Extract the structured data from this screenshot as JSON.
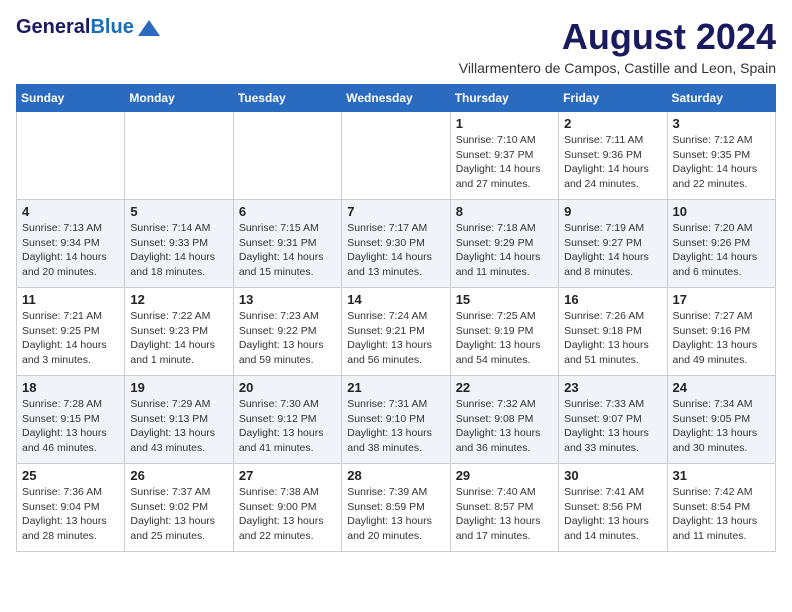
{
  "header": {
    "logo_line1": "General",
    "logo_line2": "Blue",
    "month_year": "August 2024",
    "location": "Villarmentero de Campos, Castille and Leon, Spain"
  },
  "weekdays": [
    "Sunday",
    "Monday",
    "Tuesday",
    "Wednesday",
    "Thursday",
    "Friday",
    "Saturday"
  ],
  "weeks": [
    [
      {
        "day": "",
        "info": ""
      },
      {
        "day": "",
        "info": ""
      },
      {
        "day": "",
        "info": ""
      },
      {
        "day": "",
        "info": ""
      },
      {
        "day": "1",
        "info": "Sunrise: 7:10 AM\nSunset: 9:37 PM\nDaylight: 14 hours\nand 27 minutes."
      },
      {
        "day": "2",
        "info": "Sunrise: 7:11 AM\nSunset: 9:36 PM\nDaylight: 14 hours\nand 24 minutes."
      },
      {
        "day": "3",
        "info": "Sunrise: 7:12 AM\nSunset: 9:35 PM\nDaylight: 14 hours\nand 22 minutes."
      }
    ],
    [
      {
        "day": "4",
        "info": "Sunrise: 7:13 AM\nSunset: 9:34 PM\nDaylight: 14 hours\nand 20 minutes."
      },
      {
        "day": "5",
        "info": "Sunrise: 7:14 AM\nSunset: 9:33 PM\nDaylight: 14 hours\nand 18 minutes."
      },
      {
        "day": "6",
        "info": "Sunrise: 7:15 AM\nSunset: 9:31 PM\nDaylight: 14 hours\nand 15 minutes."
      },
      {
        "day": "7",
        "info": "Sunrise: 7:17 AM\nSunset: 9:30 PM\nDaylight: 14 hours\nand 13 minutes."
      },
      {
        "day": "8",
        "info": "Sunrise: 7:18 AM\nSunset: 9:29 PM\nDaylight: 14 hours\nand 11 minutes."
      },
      {
        "day": "9",
        "info": "Sunrise: 7:19 AM\nSunset: 9:27 PM\nDaylight: 14 hours\nand 8 minutes."
      },
      {
        "day": "10",
        "info": "Sunrise: 7:20 AM\nSunset: 9:26 PM\nDaylight: 14 hours\nand 6 minutes."
      }
    ],
    [
      {
        "day": "11",
        "info": "Sunrise: 7:21 AM\nSunset: 9:25 PM\nDaylight: 14 hours\nand 3 minutes."
      },
      {
        "day": "12",
        "info": "Sunrise: 7:22 AM\nSunset: 9:23 PM\nDaylight: 14 hours\nand 1 minute."
      },
      {
        "day": "13",
        "info": "Sunrise: 7:23 AM\nSunset: 9:22 PM\nDaylight: 13 hours\nand 59 minutes."
      },
      {
        "day": "14",
        "info": "Sunrise: 7:24 AM\nSunset: 9:21 PM\nDaylight: 13 hours\nand 56 minutes."
      },
      {
        "day": "15",
        "info": "Sunrise: 7:25 AM\nSunset: 9:19 PM\nDaylight: 13 hours\nand 54 minutes."
      },
      {
        "day": "16",
        "info": "Sunrise: 7:26 AM\nSunset: 9:18 PM\nDaylight: 13 hours\nand 51 minutes."
      },
      {
        "day": "17",
        "info": "Sunrise: 7:27 AM\nSunset: 9:16 PM\nDaylight: 13 hours\nand 49 minutes."
      }
    ],
    [
      {
        "day": "18",
        "info": "Sunrise: 7:28 AM\nSunset: 9:15 PM\nDaylight: 13 hours\nand 46 minutes."
      },
      {
        "day": "19",
        "info": "Sunrise: 7:29 AM\nSunset: 9:13 PM\nDaylight: 13 hours\nand 43 minutes."
      },
      {
        "day": "20",
        "info": "Sunrise: 7:30 AM\nSunset: 9:12 PM\nDaylight: 13 hours\nand 41 minutes."
      },
      {
        "day": "21",
        "info": "Sunrise: 7:31 AM\nSunset: 9:10 PM\nDaylight: 13 hours\nand 38 minutes."
      },
      {
        "day": "22",
        "info": "Sunrise: 7:32 AM\nSunset: 9:08 PM\nDaylight: 13 hours\nand 36 minutes."
      },
      {
        "day": "23",
        "info": "Sunrise: 7:33 AM\nSunset: 9:07 PM\nDaylight: 13 hours\nand 33 minutes."
      },
      {
        "day": "24",
        "info": "Sunrise: 7:34 AM\nSunset: 9:05 PM\nDaylight: 13 hours\nand 30 minutes."
      }
    ],
    [
      {
        "day": "25",
        "info": "Sunrise: 7:36 AM\nSunset: 9:04 PM\nDaylight: 13 hours\nand 28 minutes."
      },
      {
        "day": "26",
        "info": "Sunrise: 7:37 AM\nSunset: 9:02 PM\nDaylight: 13 hours\nand 25 minutes."
      },
      {
        "day": "27",
        "info": "Sunrise: 7:38 AM\nSunset: 9:00 PM\nDaylight: 13 hours\nand 22 minutes."
      },
      {
        "day": "28",
        "info": "Sunrise: 7:39 AM\nSunset: 8:59 PM\nDaylight: 13 hours\nand 20 minutes."
      },
      {
        "day": "29",
        "info": "Sunrise: 7:40 AM\nSunset: 8:57 PM\nDaylight: 13 hours\nand 17 minutes."
      },
      {
        "day": "30",
        "info": "Sunrise: 7:41 AM\nSunset: 8:56 PM\nDaylight: 13 hours\nand 14 minutes."
      },
      {
        "day": "31",
        "info": "Sunrise: 7:42 AM\nSunset: 8:54 PM\nDaylight: 13 hours\nand 11 minutes."
      }
    ]
  ]
}
